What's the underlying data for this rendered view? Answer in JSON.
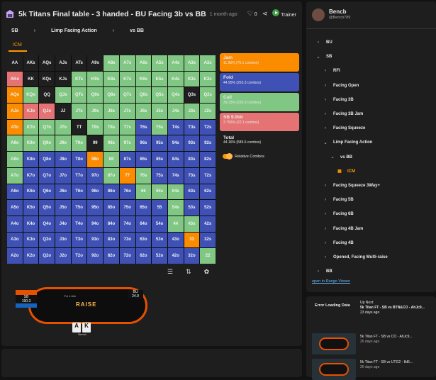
{
  "header": {
    "title": "5k Titans Final table - 3 handed - BU Facing 3b vs BB",
    "ago": "1 month ago",
    "likes": "0",
    "trainer": "Trainer"
  },
  "breadcrumb": [
    "SB",
    "Limp Facing Action",
    "vs BB"
  ],
  "tab": "ICM",
  "grid": {
    "cells": [
      [
        "AA",
        "AKs",
        "AQs",
        "AJs",
        "ATs",
        "A9s",
        "A8s",
        "A7s",
        "A6s",
        "A5s",
        "A4s",
        "A3s",
        "A2s"
      ],
      [
        "AKo",
        "KK",
        "KQs",
        "KJs",
        "KTs",
        "K9s",
        "K8s",
        "K7s",
        "K6s",
        "K5s",
        "K4s",
        "K3s",
        "K2s"
      ],
      [
        "AQo",
        "KQo",
        "QQ",
        "QJs",
        "QTs",
        "Q9s",
        "Q8s",
        "Q7s",
        "Q6s",
        "Q5s",
        "Q4s",
        "Q3s",
        "Q2s"
      ],
      [
        "AJo",
        "KJo",
        "QJo",
        "JJ",
        "JTs",
        "J9s",
        "J8s",
        "J7s",
        "J6s",
        "J5s",
        "J4s",
        "J3s",
        "J2s"
      ],
      [
        "ATo",
        "KTo",
        "QTo",
        "JTo",
        "TT",
        "T9s",
        "T8s",
        "T7s",
        "T6s",
        "T5s",
        "T4s",
        "T3s",
        "T2s"
      ],
      [
        "A9o",
        "K9o",
        "Q9o",
        "J9o",
        "T9o",
        "99",
        "98s",
        "97s",
        "96s",
        "95s",
        "94s",
        "93s",
        "92s"
      ],
      [
        "A8o",
        "K8o",
        "Q8o",
        "J8o",
        "T8o",
        "98o",
        "88",
        "87s",
        "86s",
        "85s",
        "84s",
        "83s",
        "82s"
      ],
      [
        "A7o",
        "K7o",
        "Q7o",
        "J7o",
        "T7o",
        "97o",
        "87o",
        "77",
        "76s",
        "75s",
        "74s",
        "73s",
        "72s"
      ],
      [
        "A6o",
        "K6o",
        "Q6o",
        "J6o",
        "T6o",
        "96o",
        "86o",
        "76o",
        "66",
        "65s",
        "64s",
        "63s",
        "62s"
      ],
      [
        "A5o",
        "K5o",
        "Q5o",
        "J5o",
        "T5o",
        "95o",
        "85o",
        "75o",
        "65o",
        "55",
        "54s",
        "53s",
        "52s"
      ],
      [
        "A4o",
        "K4o",
        "Q4o",
        "J4o",
        "T4o",
        "94o",
        "84o",
        "74o",
        "64o",
        "54o",
        "44",
        "43s",
        "42s"
      ],
      [
        "A3o",
        "K3o",
        "Q3o",
        "J3o",
        "T3o",
        "93o",
        "83o",
        "73o",
        "63o",
        "53o",
        "43o",
        "33",
        "32s"
      ],
      [
        "A2o",
        "K2o",
        "Q2o",
        "J2o",
        "T2o",
        "92o",
        "82o",
        "72o",
        "62o",
        "52o",
        "42o",
        "32o",
        "22"
      ]
    ],
    "colors": [
      [
        "#1f1f1f",
        "#1f1f1f",
        "#1f1f1f",
        "#1f1f1f",
        "#1f1f1f",
        "#1f1f1f",
        "#81c784",
        "#81c784",
        "#81c784",
        "#81c784",
        "#81c784",
        "#81c784",
        "#81c784"
      ],
      [
        "#e57373",
        "#1f1f1f",
        "#1f1f1f",
        "#1f1f1f",
        "#81c784",
        "#81c784",
        "#81c784",
        "#81c784",
        "#81c784",
        "#81c784",
        "#81c784",
        "#81c784",
        "#81c784"
      ],
      [
        "#fb8c00",
        "#81c784",
        "#1f1f1f",
        "#81c784",
        "#81c784",
        "#81c784",
        "#81c784",
        "#81c784",
        "#81c784",
        "#81c784",
        "#81c784",
        "#1f1f1f",
        "#81c784"
      ],
      [
        "#fb8c00",
        "#e57373",
        "#e57373",
        "#1f1f1f",
        "#81c784",
        "#81c784",
        "#81c784",
        "#81c784",
        "#81c784",
        "#81c784",
        "#81c784",
        "#81c784",
        "#81c784"
      ],
      [
        "#fb8c00",
        "#81c784",
        "#81c784",
        "#81c784",
        "#1f1f1f",
        "#81c784",
        "#81c784",
        "#81c784",
        "#3f51b5",
        "#81c784",
        "#3f51b5",
        "#3f51b5",
        "#3f51b5"
      ],
      [
        "#81c784",
        "#81c784",
        "#81c784",
        "#81c784",
        "#81c784",
        "#1f1f1f",
        "#81c784",
        "#81c784",
        "#3f51b5",
        "#3f51b5",
        "#3f51b5",
        "#3f51b5",
        "#3f51b5"
      ],
      [
        "#81c784",
        "#3f51b5",
        "#3f51b5",
        "#3f51b5",
        "#3f51b5",
        "#fb8c00",
        "#81c784",
        "#3f51b5",
        "#3f51b5",
        "#3f51b5",
        "#3f51b5",
        "#3f51b5",
        "#3f51b5"
      ],
      [
        "#81c784",
        "#3f51b5",
        "#3f51b5",
        "#3f51b5",
        "#3f51b5",
        "#3f51b5",
        "#81c784",
        "#fb8c00",
        "#81c784",
        "#3f51b5",
        "#3f51b5",
        "#3f51b5",
        "#3f51b5"
      ],
      [
        "#3f51b5",
        "#3f51b5",
        "#3f51b5",
        "#3f51b5",
        "#3f51b5",
        "#3f51b5",
        "#3f51b5",
        "#3f51b5",
        "#81c784",
        "#81c784",
        "#81c784",
        "#3f51b5",
        "#3f51b5"
      ],
      [
        "#3f51b5",
        "#3f51b5",
        "#3f51b5",
        "#3f51b5",
        "#3f51b5",
        "#3f51b5",
        "#3f51b5",
        "#3f51b5",
        "#3f51b5",
        "#3f51b5",
        "#81c784",
        "#3f51b5",
        "#3f51b5"
      ],
      [
        "#3f51b5",
        "#3f51b5",
        "#3f51b5",
        "#3f51b5",
        "#3f51b5",
        "#3f51b5",
        "#3f51b5",
        "#3f51b5",
        "#3f51b5",
        "#3f51b5",
        "#81c784",
        "#81c784",
        "#3f51b5"
      ],
      [
        "#3f51b5",
        "#3f51b5",
        "#3f51b5",
        "#3f51b5",
        "#3f51b5",
        "#3f51b5",
        "#3f51b5",
        "#3f51b5",
        "#3f51b5",
        "#3f51b5",
        "#3f51b5",
        "#fb8c00",
        "#3f51b5"
      ],
      [
        "#3f51b5",
        "#3f51b5",
        "#3f51b5",
        "#3f51b5",
        "#3f51b5",
        "#3f51b5",
        "#3f51b5",
        "#3f51b5",
        "#3f51b5",
        "#3f51b5",
        "#3f51b5",
        "#3f51b5",
        "#81c784"
      ]
    ]
  },
  "legend": {
    "jam": {
      "label": "Jam",
      "sub": "11.96% (70.1 combos)"
    },
    "fold": {
      "label": "Fold",
      "sub": "44.95% (263.3 combos)"
    },
    "call": {
      "label": "Call",
      "sub": "39.33% (230.3 combos)"
    },
    "sb": {
      "label": "SB 9.0bb",
      "sub": "3.756% (22.1 combos)"
    },
    "total": {
      "label": "Total",
      "sub": "44.16% (585.6 combos)"
    },
    "relative": "Relative Combos"
  },
  "table": {
    "sb_name": "SB",
    "sb_stack": "190.3",
    "bb_name": "BU",
    "bb_stack": "24.9",
    "pot": "Pot 4.6bb",
    "logo": "RAISE",
    "hero_cards": [
      "A",
      "K"
    ],
    "hero_name": "Bencb"
  },
  "profile": {
    "name": "Bencb",
    "handle": "@Bencb789"
  },
  "tree": [
    {
      "label": "BU",
      "level": 0,
      "chevron": "›"
    },
    {
      "label": "SB",
      "level": 0,
      "chevron": "⌄"
    },
    {
      "label": "RFI",
      "level": 1,
      "chevron": "›"
    },
    {
      "label": "Facing Open",
      "level": 1,
      "chevron": "›"
    },
    {
      "label": "Facing 3B",
      "level": 1,
      "chevron": "›"
    },
    {
      "label": "Facing 3B Jam",
      "level": 1,
      "chevron": "›"
    },
    {
      "label": "Facing Squeeze",
      "level": 1,
      "chevron": "›"
    },
    {
      "label": "Limp Facing Action",
      "level": 1,
      "chevron": "⌄"
    },
    {
      "label": "vs BB",
      "level": 2,
      "chevron": "⌄"
    },
    {
      "label": "ICM",
      "level": 3,
      "chevron": ""
    },
    {
      "label": "Facing Squeeze 3Way+",
      "level": 1,
      "chevron": "›"
    },
    {
      "label": "Facing 5B",
      "level": 1,
      "chevron": "›"
    },
    {
      "label": "Facing 6B",
      "level": 1,
      "chevron": "›"
    },
    {
      "label": "Facing 4B Jam",
      "level": 1,
      "chevron": "›"
    },
    {
      "label": "Facing 4B",
      "level": 1,
      "chevron": "›"
    },
    {
      "label": "Opened, Facing Multi-raise",
      "level": 1,
      "chevron": "›"
    },
    {
      "label": "BB",
      "level": 0,
      "chevron": "›"
    }
  ],
  "open_link": "open in Range Viewer",
  "upnext": {
    "error": "Error Loading Data",
    "label": "Up Next:",
    "title": "5k Titan FT - SB vs BTN&CO - AhJc9...",
    "ago": "23 days ago",
    "videos": [
      {
        "title": "5k Titan FT - SB vs CO - AhJc9...",
        "ago": "26 days ago"
      },
      {
        "title": "5k Titan FT - SB vs UTG2 - 8d5...",
        "ago": "26 days ago"
      }
    ]
  }
}
